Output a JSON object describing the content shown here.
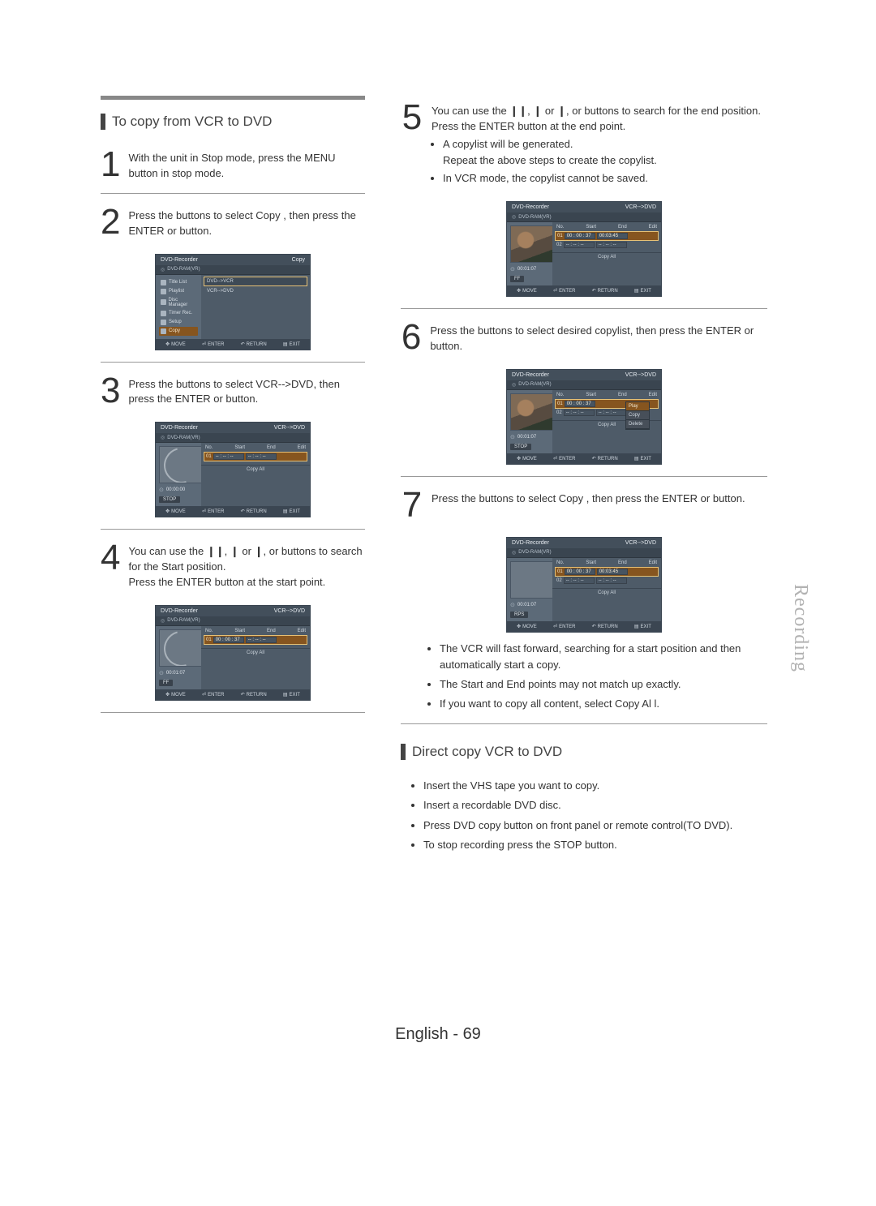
{
  "side_tab": "Recording",
  "footer": {
    "lang": "English",
    "sep": " - ",
    "page": "69"
  },
  "left": {
    "title": "To copy from VCR to DVD",
    "step1": "With the unit in Stop mode, press the MENU button in stop mode.",
    "step2a": "Press the ",
    "step2b": " buttons to select Copy , then press the ENTER or ",
    "step2c": " button.",
    "step3a": "Press the ",
    "step3b": " buttons to select VCR-->DVD, then press the ENTER or ",
    "step3c": " button.",
    "step4a": "You can use the ",
    "step4b": " or ",
    "step4c": " or buttons to search for the Start position.",
    "step4d": "Press the ENTER button at the start point."
  },
  "right": {
    "step5a": "You can use the ",
    "step5b": " or ",
    "step5c": " or buttons to search for the end position.",
    "step5d": "Press the ENTER button at the end point.",
    "step5_bul1": "A copylist will be generated.",
    "step5_bul1b": "Repeat the above steps to create the copylist.",
    "step5_bul2": "In VCR mode, the copylist cannot be saved.",
    "step6a": "Press the ",
    "step6b": " buttons to select desired copylist, then press the ENTER or ",
    "step6c": " button.",
    "step7a": "Press the ",
    "step7b": " buttons to select Copy , then press the ENTER or ",
    "step7c": " button.",
    "note1": "The VCR will fast forward, searching for a start position and then automatically start a copy.",
    "note2": "The Start and End points may not match up exactly.",
    "note3": "If you want to copy all content, select Copy Al l.",
    "direct_title": "Direct copy VCR to DVD",
    "d1": "Insert the VHS tape you want to copy.",
    "d2": "Insert a recordable DVD disc.",
    "d3": "Press DVD copy button on front panel or remote control(TO DVD).",
    "d4": "To stop recording press the STOP button."
  },
  "sym": {
    "pause_skip": "❙❙, ❙",
    "skip": "❙,"
  },
  "osd_common": {
    "title": "DVD-Recorder",
    "sub": "DVD-RAM(VR)",
    "copyall": "Copy All",
    "ft_move": "MOVE",
    "ft_enter": "ENTER",
    "ft_return": "RETURN",
    "ft_exit": "EXIT"
  },
  "osdA": {
    "hdr_right": "Copy",
    "menu": [
      "Title List",
      "Playlist",
      "Disc Manager",
      "Timer Rec.",
      "Setup",
      "Copy"
    ],
    "menu_sel": 5,
    "opts": [
      "DVD-->VCR",
      "VCR-->DVD"
    ],
    "opt_sel": 0
  },
  "osdB": {
    "hdr_right": "VCR-->DVD",
    "col_no": "No.",
    "col_start": "Start",
    "col_end": "End",
    "col_edit": "Edit",
    "row1_no": "01",
    "row1_start": "-- : -- : --",
    "row1_end": "-- : -- : --",
    "time": "00:00:00",
    "state": "STOP"
  },
  "osdC": {
    "hdr_right": "VCR-->DVD",
    "row1_no": "01",
    "row1_start": "00 : 00 : 37",
    "row1_end": "-- : -- : --",
    "time": "00:01:07",
    "state": "FF"
  },
  "osdD": {
    "hdr_right": "VCR-->DVD",
    "row1_no": "01",
    "row1_start": "00 : 00 : 37",
    "row1_end": "00:03:45",
    "row2_no": "02",
    "row2_start": "-- : -- : --",
    "row2_end": "-- : -- : --",
    "time": "00:01:07",
    "state": "FF"
  },
  "osdE": {
    "hdr_right": "VCR-->DVD",
    "row1_no": "01",
    "row1_start": "00 : 00 : 37",
    "row2_no": "02",
    "row2_start": "-- : -- : --",
    "row2_end": "-- : -- : --",
    "ctx": [
      "Play",
      "Copy",
      "Delete"
    ],
    "ctx_sel": 0,
    "time": "00:01:07",
    "state": "STOP"
  },
  "osdF": {
    "hdr_right": "VCR-->DVD",
    "row1_no": "01",
    "row1_start": "00 : 00 : 37",
    "row1_end": "00:03:45",
    "row2_no": "02",
    "row2_start": "-- : -- : --",
    "row2_end": "-- : -- : --",
    "time": "00:01:07",
    "state": "RPS"
  }
}
